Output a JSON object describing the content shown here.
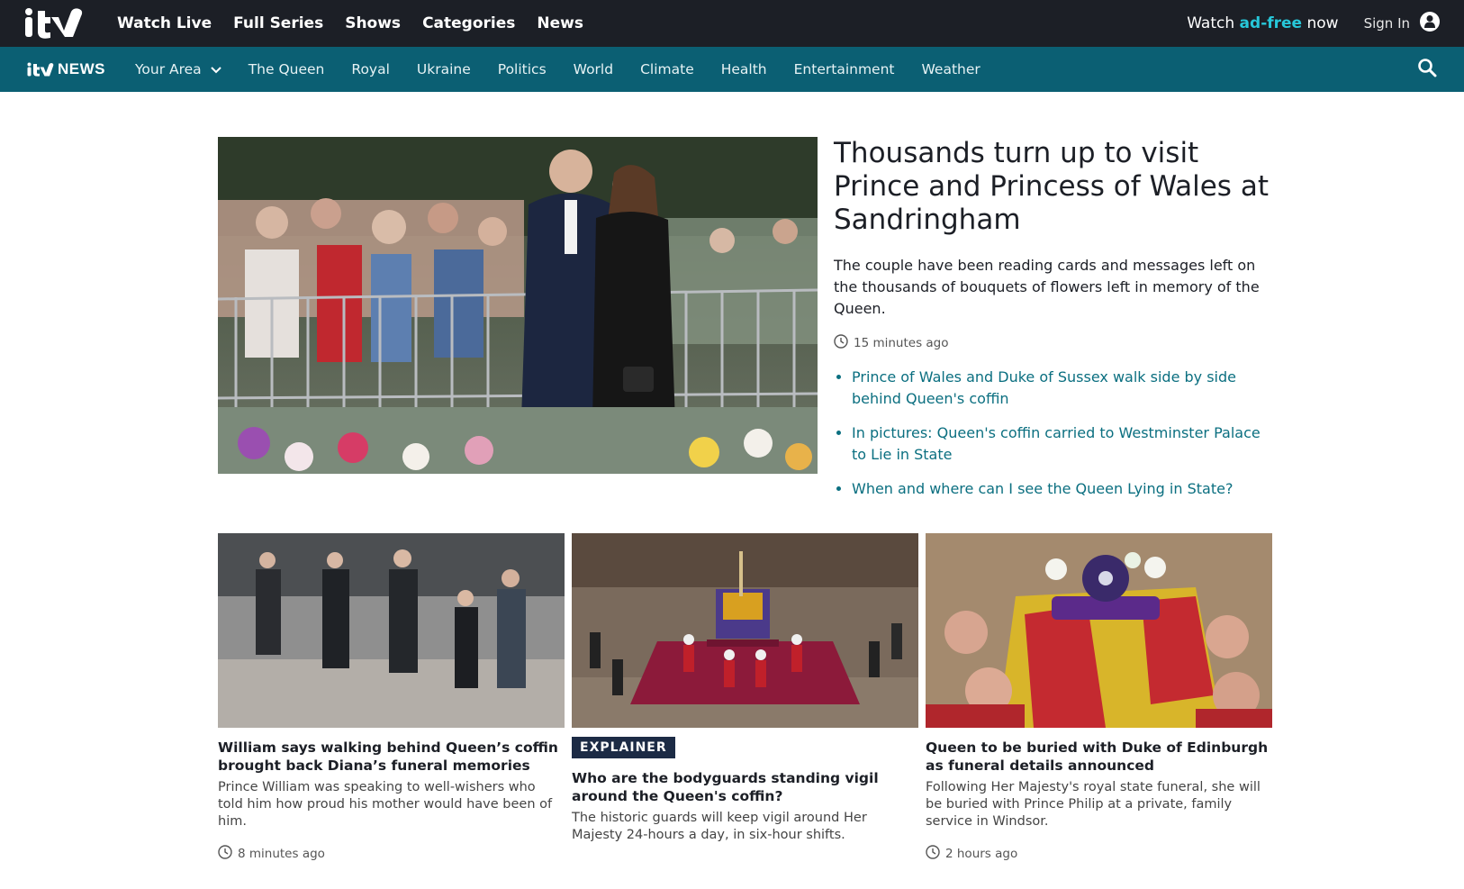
{
  "topbar": {
    "nav": [
      "Watch Live",
      "Full Series",
      "Shows",
      "Categories",
      "News"
    ],
    "watch_prefix": "Watch ",
    "watch_accent": "ad-free",
    "watch_suffix": " now",
    "sign_in": "Sign In"
  },
  "newsbar": {
    "logo_text": "NEWS",
    "your_area": "Your Area",
    "nav": [
      "The Queen",
      "Royal",
      "Ukraine",
      "Politics",
      "World",
      "Climate",
      "Health",
      "Entertainment",
      "Weather"
    ]
  },
  "hero": {
    "title": "Thousands turn up to visit Prince and Princess of Wales at Sandringham",
    "summary": "The couple have been reading cards and messages left on the thousands of bouquets of flowers left in memory of the Queen.",
    "time": "15 minutes ago",
    "related": [
      "Prince of Wales and Duke of Sussex walk side by side behind Queen's coffin",
      "In pictures: Queen's coffin carried to Westminster Palace to Lie in State",
      "When and where can I see the Queen Lying in State?"
    ]
  },
  "cards": [
    {
      "title": "William says walking behind Queen’s coffin brought back Diana’s funeral memories",
      "summary": "Prince William was speaking to well-wishers who told him how proud his mother would have been of him.",
      "time": "8 minutes ago"
    },
    {
      "badge": "EXPLAINER",
      "title": "Who are the bodyguards standing vigil around the Queen's coffin?",
      "summary": "The historic guards will keep vigil around Her Majesty 24-hours a day, in six-hour shifts."
    },
    {
      "title": "Queen to be buried with Duke of Edinburgh as funeral details announced",
      "summary": "Following Her Majesty's royal state funeral, she will be buried with Prince Philip at a private, family service in Windsor.",
      "time": "2 hours ago"
    }
  ],
  "colors": {
    "topbar_bg": "#1c1f26",
    "newsbar_bg": "#0b5f73",
    "accent": "#27c7d9",
    "link": "#0b6f80"
  },
  "icons": [
    "itv-logo",
    "user-icon",
    "chevron-down-icon",
    "search-icon",
    "clock-icon"
  ]
}
